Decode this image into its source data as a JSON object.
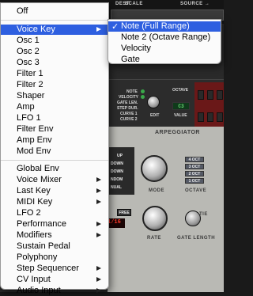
{
  "main_menu": {
    "items": [
      {
        "label": "Off",
        "submenu": false,
        "highlighted": false
      },
      {
        "label": "Voice Key",
        "submenu": true,
        "highlighted": true
      },
      {
        "label": "Osc 1",
        "submenu": false,
        "highlighted": false
      },
      {
        "label": "Osc 2",
        "submenu": false,
        "highlighted": false
      },
      {
        "label": "Osc 3",
        "submenu": false,
        "highlighted": false
      },
      {
        "label": "Filter 1",
        "submenu": false,
        "highlighted": false
      },
      {
        "label": "Filter 2",
        "submenu": false,
        "highlighted": false
      },
      {
        "label": "Shaper",
        "submenu": false,
        "highlighted": false
      },
      {
        "label": "Amp",
        "submenu": false,
        "highlighted": false
      },
      {
        "label": "LFO 1",
        "submenu": false,
        "highlighted": false
      },
      {
        "label": "Filter Env",
        "submenu": false,
        "highlighted": false
      },
      {
        "label": "Amp Env",
        "submenu": false,
        "highlighted": false
      },
      {
        "label": "Mod Env",
        "submenu": false,
        "highlighted": false
      },
      {
        "label": "Global Env",
        "submenu": false,
        "highlighted": false
      },
      {
        "label": "Voice Mixer",
        "submenu": true,
        "highlighted": false
      },
      {
        "label": "Last Key",
        "submenu": true,
        "highlighted": false
      },
      {
        "label": "MIDI Key",
        "submenu": true,
        "highlighted": false
      },
      {
        "label": "LFO 2",
        "submenu": false,
        "highlighted": false
      },
      {
        "label": "Performance",
        "submenu": true,
        "highlighted": false
      },
      {
        "label": "Modifiers",
        "submenu": true,
        "highlighted": false
      },
      {
        "label": "Sustain Pedal",
        "submenu": false,
        "highlighted": false
      },
      {
        "label": "Polyphony",
        "submenu": false,
        "highlighted": false
      },
      {
        "label": "Step Sequencer",
        "submenu": true,
        "highlighted": false
      },
      {
        "label": "CV Input",
        "submenu": true,
        "highlighted": false
      },
      {
        "label": "Audio Input",
        "submenu": true,
        "highlighted": false
      }
    ]
  },
  "sub_menu": {
    "items": [
      {
        "label": "Note (Full Range)",
        "checked": true,
        "highlighted": true
      },
      {
        "label": "Note 2 (Octave Range)",
        "checked": false,
        "highlighted": false
      },
      {
        "label": "Velocity",
        "checked": false,
        "highlighted": false
      },
      {
        "label": "Gate",
        "checked": false,
        "highlighted": false
      }
    ],
    "check_glyph": "✓"
  },
  "background": {
    "top_labels": [
      "DEST",
      "SCALE",
      "SOURCE →"
    ],
    "mod_labels": [
      "NOTE",
      "VELOCITY",
      "GATE LEN.",
      "STEP DUR.",
      "CURVE 1",
      "CURVE 2"
    ],
    "octave_label": "OCTAVE",
    "edit_label": "EDIT",
    "value_label": "VALUE",
    "lcd_value": "C3",
    "arp_title": "ARPEGGIATOR",
    "arp_modes": [
      "UP",
      "DOWN",
      "DOWN",
      "NDOM",
      "NUAL"
    ],
    "octave_buttons": [
      "4 OCT",
      "3 OCT",
      "2 OCT",
      "1 OCT"
    ],
    "mode_label": "MODE",
    "octave_label2": "OCTAVE",
    "free_label": "FREE",
    "rate_display": "1/16",
    "rate_label": "RATE",
    "gate_length_label": "GATE LENGTH",
    "tie_label": "TIE"
  }
}
